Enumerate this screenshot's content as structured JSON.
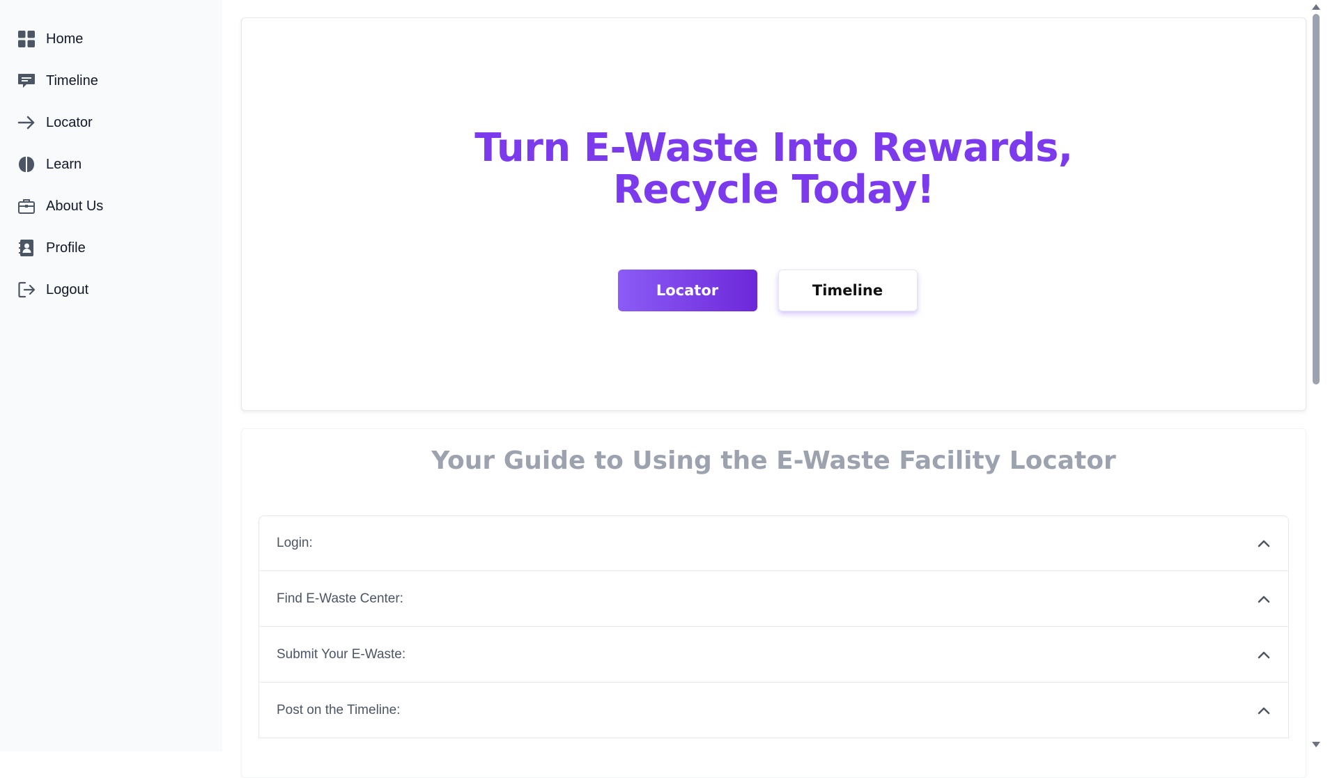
{
  "sidebar": {
    "items": [
      {
        "label": "Home",
        "icon": "grid-icon"
      },
      {
        "label": "Timeline",
        "icon": "message-icon"
      },
      {
        "label": "Locator",
        "icon": "arrow-right-icon"
      },
      {
        "label": "Learn",
        "icon": "brain-icon"
      },
      {
        "label": "About Us",
        "icon": "briefcase-icon"
      },
      {
        "label": "Profile",
        "icon": "contact-book-icon"
      },
      {
        "label": "Logout",
        "icon": "logout-icon"
      }
    ]
  },
  "hero": {
    "title_line1": "Turn E-Waste Into Rewards,",
    "title_line2": "Recycle Today!",
    "primary_button": "Locator",
    "secondary_button": "Timeline"
  },
  "guide": {
    "title": "Your Guide to Using the E-Waste Facility Locator",
    "items": [
      {
        "label": "Login:"
      },
      {
        "label": "Find E-Waste Center:"
      },
      {
        "label": "Submit Your E-Waste:"
      },
      {
        "label": "Post on the Timeline:"
      }
    ]
  },
  "colors": {
    "accent": "#7c3aed",
    "sidebar_bg": "#f9fafb",
    "icon": "#4b5563",
    "muted_heading": "#9ca3af"
  }
}
